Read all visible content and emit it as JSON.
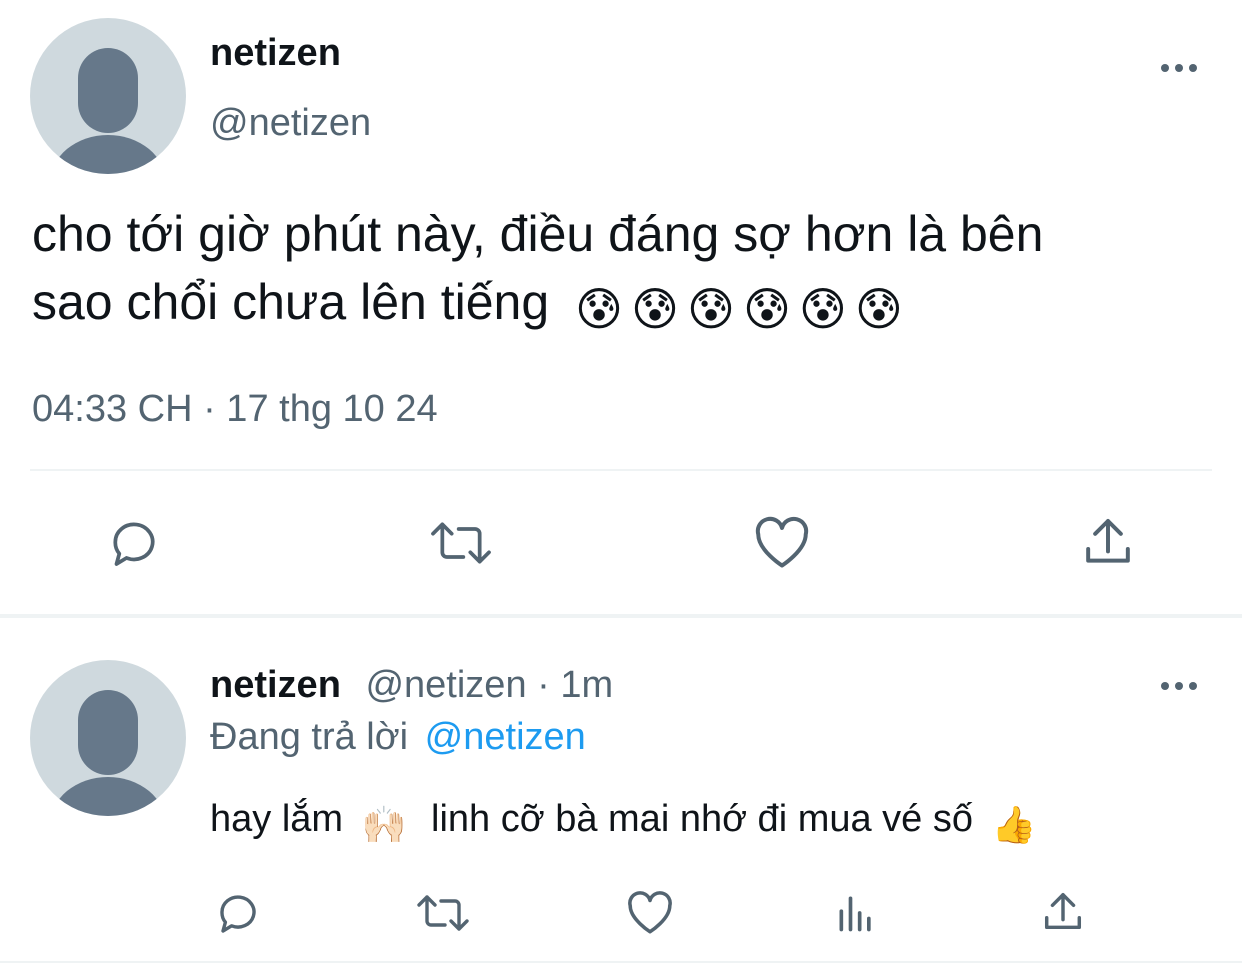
{
  "main_tweet": {
    "display_name": "netizen",
    "handle": "@netizen",
    "text": "cho tới giờ phút này, điều đáng sợ hơn là bên",
    "text_line2": "sao chổi chưa lên tiếng",
    "emoji_count_label": "😰😰😰😰😰😰",
    "timestamp": "04:33 CH · 17 thg 10 24",
    "actions": [
      "reply-icon",
      "retweet-icon",
      "like-icon",
      "share-icon"
    ]
  },
  "reply": {
    "display_name": "netizen",
    "meta": "@netizen · 1m",
    "replying_prefix": "Đang trả lời",
    "replying_to": "@netizen",
    "text_part1": "hay lắm",
    "text_part2": "linh cỡ bà mai nhớ đi mua vé số",
    "emoji_hands": "🙌🏻",
    "emoji_thumb": "👍",
    "actions": [
      "reply-icon",
      "retweet-icon",
      "like-icon",
      "views-icon",
      "share-icon"
    ]
  },
  "colors": {
    "text": "#0f1419",
    "muted": "#536471",
    "link": "#1d9bf0",
    "avatar_bg": "#cfd9de",
    "avatar_fg": "#66788a",
    "divider": "#eff3f4"
  }
}
